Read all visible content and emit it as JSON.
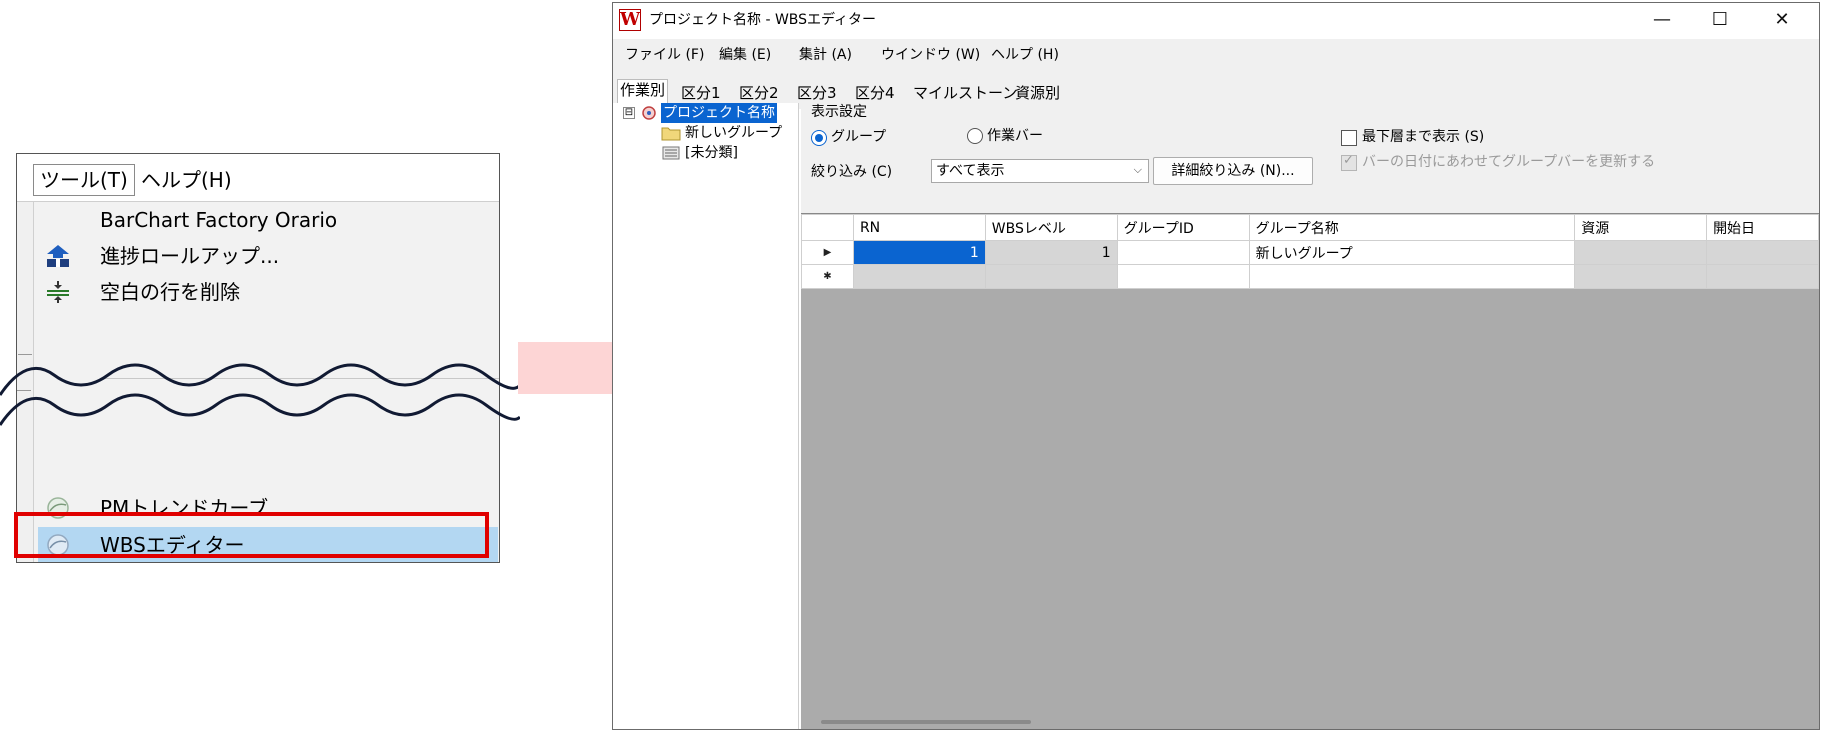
{
  "menu_crop": {
    "menubar": {
      "tools": "ツール(T)",
      "help": "ヘルプ(H)"
    },
    "items": [
      {
        "label": "BarChart Factory Orario",
        "icon": "none"
      },
      {
        "label": "進捗ロールアップ...",
        "icon": "rollup-icon"
      },
      {
        "label": "空白の行を削除",
        "icon": "delete-blank-rows-icon"
      },
      {
        "label": "PMトレンドカーブ",
        "icon": "trend-curve-icon"
      },
      {
        "label": "WBSエディター",
        "icon": "wbs-editor-icon"
      }
    ],
    "highlight_color": "#e00000",
    "selected_bg": "#b3d7f2"
  },
  "arrow": {
    "color": "#fdd5d5",
    "icon": "right-arrow-icon"
  },
  "window": {
    "logo": "W",
    "title": "プロジェクト名称 - WBSエディター",
    "controls": {
      "minimize": "—",
      "maximize": "☐",
      "close": "✕"
    },
    "menus": [
      "ファイル (F)",
      "編集 (E)",
      "集計 (A)",
      "ウインドウ (W)",
      "ヘルプ (H)"
    ],
    "tabs": [
      "作業別",
      "区分1",
      "区分2",
      "区分3",
      "区分4",
      "マイルストーン",
      "資源別"
    ],
    "tree": {
      "root": "プロジェクト名称",
      "children": [
        "新しいグループ",
        "[未分類]"
      ],
      "expander": "⊟"
    },
    "settings": {
      "group_title": "表示設定",
      "radio_group": "グループ",
      "radio_bar": "作業バー",
      "filter_label": "絞り込み (C)",
      "filter_value": "すべて表示",
      "detail_button": "詳細絞り込み (N)...",
      "check_lowest": "最下層まで表示 (S)",
      "check_update": "バーの日付にあわせてグループバーを更新する"
    },
    "grid": {
      "columns": [
        "RN",
        "WBSレベル",
        "グループID",
        "グループ名称",
        "資源",
        "開始日"
      ],
      "rows": [
        {
          "marker": "▶",
          "rn": "1",
          "wbs_level": "1",
          "group_id": "",
          "group_name": "新しいグループ",
          "resource": "",
          "start": ""
        },
        {
          "marker": "✱",
          "rn": "",
          "wbs_level": "",
          "group_id": "",
          "group_name": "",
          "resource": "",
          "start": ""
        }
      ]
    },
    "colors": {
      "selection": "#0a64d0",
      "grid_bg": "#ababab"
    }
  }
}
